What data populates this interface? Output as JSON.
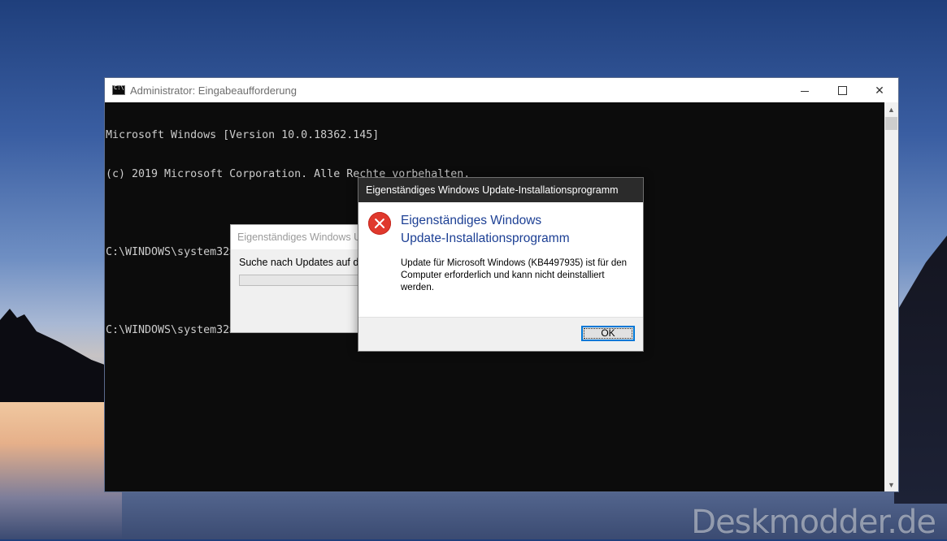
{
  "console_window": {
    "title": "Administrator: Eingabeaufforderung",
    "lines": [
      "Microsoft Windows [Version 10.0.18362.145]",
      "(c) 2019 Microsoft Corporation. Alle Rechte vorbehalten.",
      "",
      "C:\\WINDOWS\\system32>WUSA /UNINSTALL /KB:4497935",
      "",
      "C:\\WINDOWS\\system32>"
    ]
  },
  "background_dialog": {
    "title": "Eigenständiges Windows Update-Installationsprogramm",
    "text": "Suche nach Updates auf diesem Computer..."
  },
  "error_dialog": {
    "title": "Eigenständiges Windows Update-Installationsprogramm",
    "heading_line1": "Eigenständiges Windows",
    "heading_line2": "Update-Installationsprogramm",
    "message": "Update für Microsoft Windows (KB4497935) ist für den Computer erforderlich und kann nicht deinstalliert werden.",
    "ok_label": "OK",
    "icon": "error-icon"
  },
  "window_buttons": {
    "minimize": "—",
    "close": "✕"
  },
  "watermark": "Deskmodder.de",
  "colors": {
    "console_bg": "#0c0c0c",
    "console_text": "#cccccc",
    "heading_blue": "#1c3f94",
    "error_red": "#e0382c",
    "focus_blue": "#0078d7"
  }
}
